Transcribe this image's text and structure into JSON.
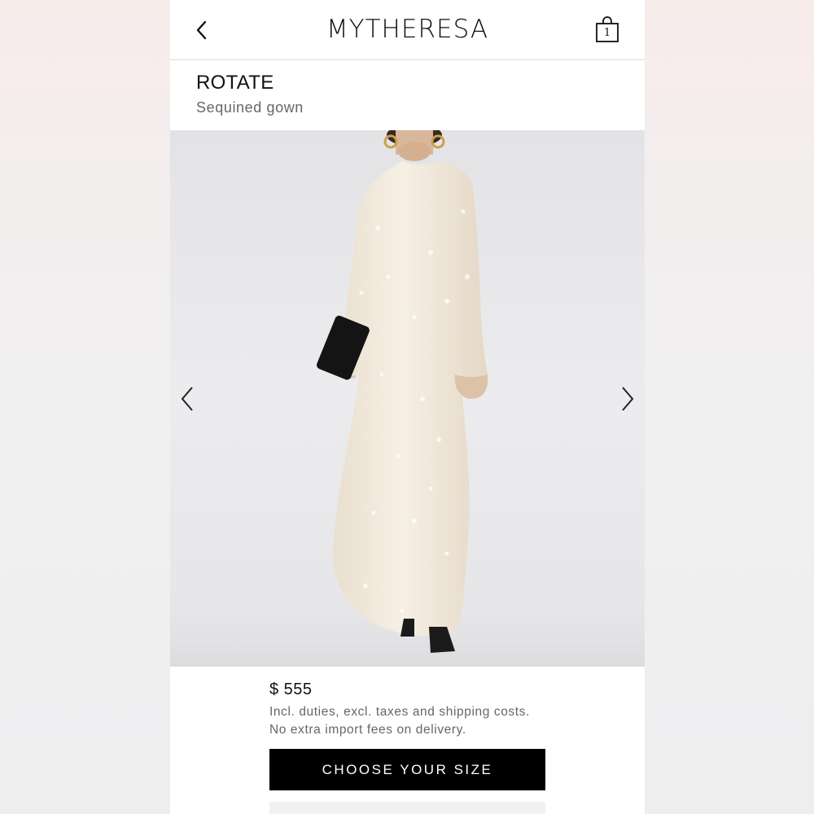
{
  "header": {
    "logo": "MYTHERESA",
    "bag_count": "1"
  },
  "product": {
    "brand": "ROTATE",
    "name": "Sequined gown"
  },
  "pricing": {
    "price": "$ 555",
    "note_line1": "Incl. duties, excl. taxes and shipping costs.",
    "note_line2": "No extra import fees on delivery."
  },
  "actions": {
    "choose_size": "CHOOSE YOUR SIZE"
  },
  "icons": {
    "back": "chevron-left-icon",
    "bag": "shopping-bag-icon",
    "prev": "chevron-left-icon",
    "next": "chevron-right-icon"
  },
  "colors": {
    "cta_background": "#000000",
    "cta_text": "#ffffff",
    "gown": "#f2e9dc"
  }
}
